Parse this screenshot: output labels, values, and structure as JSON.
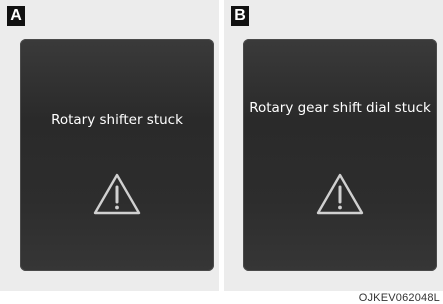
{
  "panels": [
    {
      "tag": "A",
      "message": "Rotary shifter stuck",
      "icon": "warning-triangle-icon"
    },
    {
      "tag": "B",
      "message": "Rotary gear shift dial stuck",
      "icon": "warning-triangle-icon"
    }
  ],
  "figure_code": "OJKEV062048L",
  "colors": {
    "panel_background": "#ececec",
    "display_background": "#2d2d2d",
    "display_text": "#ffffff",
    "tag_background": "#111111",
    "tag_text": "#ffffff",
    "icon_stroke": "#d0d0d0"
  }
}
